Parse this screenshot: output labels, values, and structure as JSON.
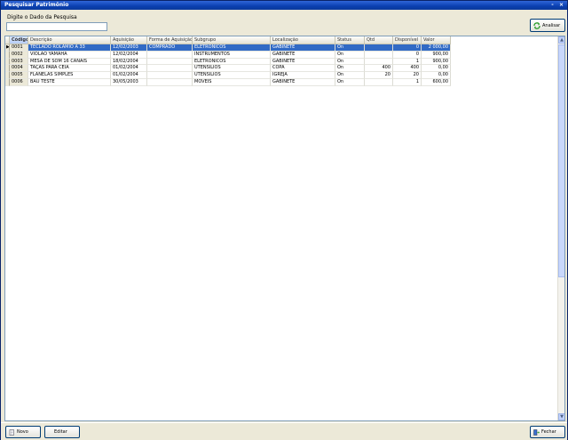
{
  "window": {
    "title": "Pesquisar Patrimônio",
    "minimize_glyph": "-",
    "close_glyph": "×"
  },
  "search": {
    "label": "Digite o Dado da Pesquisa",
    "value": ""
  },
  "toolbar": {
    "analyze_label": "Analisar"
  },
  "grid": {
    "columns": [
      "Código",
      "Descrição",
      "Aquisição",
      "Forma de Aquisição",
      "Subgrupo",
      "Localização",
      "Status",
      "Qtd",
      "Disponível",
      "Valor"
    ],
    "rows": [
      {
        "code": "0001",
        "description": "TECLADO ROLAMIO A 33",
        "acquisition": "12/02/2003",
        "form": "COMPRADO",
        "subgroup": "ELETRÔNICOS",
        "location": "GABINETE",
        "status": "On",
        "qty": "",
        "available": "0",
        "value": "2 000,00",
        "selected": true
      },
      {
        "code": "0002",
        "description": "VIOLÃO YAMAHA",
        "acquisition": "12/02/2004",
        "form": "",
        "subgroup": "INSTRUMENTOS",
        "location": "GABINETE",
        "status": "On",
        "qty": "",
        "available": "0",
        "value": "900,00",
        "selected": false
      },
      {
        "code": "0003",
        "description": "MESA DE SOM 16 CANAIS",
        "acquisition": "18/02/2004",
        "form": "",
        "subgroup": "ELETRÔNICOS",
        "location": "GABINETE",
        "status": "On",
        "qty": "",
        "available": "1",
        "value": "900,00",
        "selected": false
      },
      {
        "code": "0004",
        "description": "TAÇAS PARA CEIA",
        "acquisition": "01/02/2004",
        "form": "",
        "subgroup": "UTENSÍLIOS",
        "location": "COPA",
        "status": "On",
        "qty": "400",
        "available": "400",
        "value": "0,00",
        "selected": false
      },
      {
        "code": "0005",
        "description": "FLANELAS SIMPLES",
        "acquisition": "01/02/2004",
        "form": "",
        "subgroup": "UTENSÍLIOS",
        "location": "IGREJA",
        "status": "On",
        "qty": "20",
        "available": "20",
        "value": "0,00",
        "selected": false
      },
      {
        "code": "0006",
        "description": "BAÚ TESTE",
        "acquisition": "30/05/2003",
        "form": "",
        "subgroup": "MÓVEIS",
        "location": "GABINETE",
        "status": "On",
        "qty": "",
        "available": "1",
        "value": "600,00",
        "selected": false
      }
    ]
  },
  "footer": {
    "new_label": "Novo",
    "edit_label": "Editar",
    "close_label": "Fechar"
  },
  "colors": {
    "selection": "#316ac5",
    "titlebar": "#0a3fb0",
    "window_bg": "#ece9d8"
  }
}
